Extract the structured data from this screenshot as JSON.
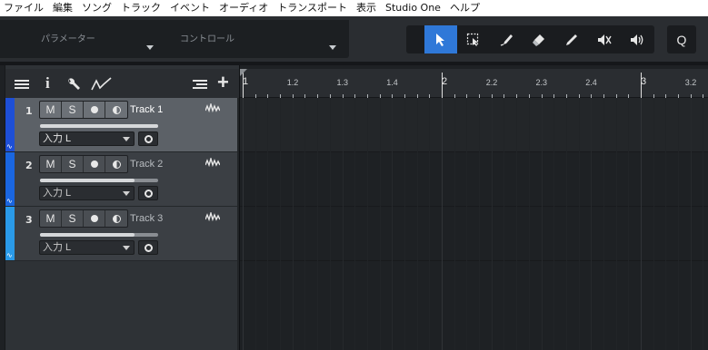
{
  "menu": [
    "ファイル",
    "編集",
    "ソング",
    "トラック",
    "イベント",
    "オーディオ",
    "トランスポート",
    "表示",
    "Studio One",
    "ヘルプ"
  ],
  "toolbar": {
    "param_label": "パラメーター",
    "control_label": "コントロール",
    "tools": [
      "arrow-tool",
      "range-tool",
      "split-tool",
      "eraser-tool",
      "paint-tool",
      "mute-tool",
      "listen-tool"
    ],
    "active_tool": "arrow-tool",
    "quantize_label": "Q",
    "accent_color": "#2f78d8"
  },
  "track_header": {
    "icons": [
      "list-icon",
      "info-icon",
      "wrench-icon",
      "automation-icon",
      "tracklist-icon",
      "add-track-icon"
    ],
    "info_label": "i",
    "add_label": "+"
  },
  "tracks": [
    {
      "number": "1",
      "name": "Track 1",
      "input": "入力 L",
      "color": "#1e4fd6",
      "selected": true,
      "buttons": [
        "M",
        "S"
      ],
      "volume": 0.82
    },
    {
      "number": "2",
      "name": "Track 2",
      "input": "入力 L",
      "color": "#1a66e0",
      "selected": false,
      "buttons": [
        "M",
        "S"
      ],
      "volume": 0.74
    },
    {
      "number": "3",
      "name": "Track 3",
      "input": "入力 L",
      "color": "#2a9ae8",
      "selected": false,
      "buttons": [
        "M",
        "S"
      ],
      "volume": 0.74
    }
  ],
  "ruler": {
    "labels": [
      "1",
      "1.2",
      "1.3",
      "1.4",
      "2",
      "2.2",
      "2.3",
      "2.4",
      "3",
      "3.2"
    ],
    "major": [
      "1",
      "2",
      "3"
    ]
  }
}
